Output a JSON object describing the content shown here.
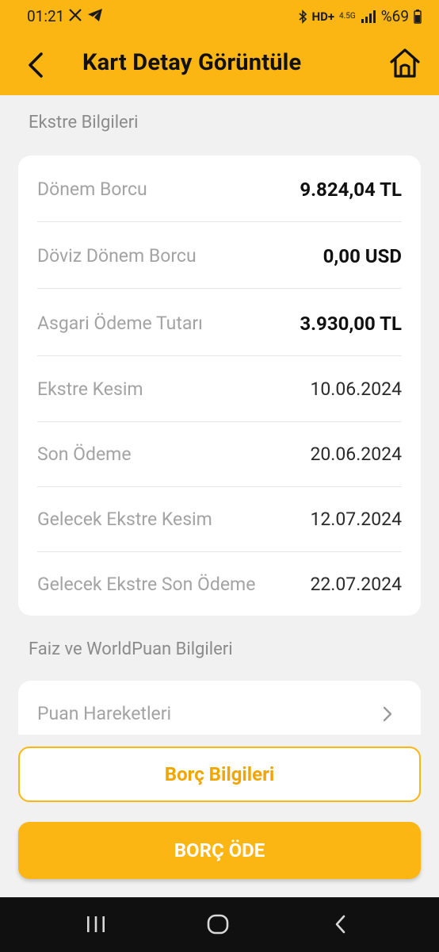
{
  "status": {
    "time": "01:21",
    "network": "4.5G",
    "battery": "%69"
  },
  "header": {
    "title": "Kart Detay Görüntüle"
  },
  "statement": {
    "section_title": "Ekstre Bilgileri",
    "rows": [
      {
        "label": "Dönem Borcu",
        "value": "9.824,04 TL"
      },
      {
        "label": "Döviz Dönem Borcu",
        "value": "0,00 USD"
      },
      {
        "label": "Asgari Ödeme Tutarı",
        "value": "3.930,00 TL"
      },
      {
        "label": "Ekstre Kesim",
        "value": "10.06.2024"
      },
      {
        "label": "Son Ödeme",
        "value": "20.06.2024"
      },
      {
        "label": "Gelecek Ekstre Kesim",
        "value": "12.07.2024"
      },
      {
        "label": "Gelecek Ekstre Son Ödeme",
        "value": "22.07.2024"
      }
    ]
  },
  "points": {
    "section_title": "Faiz ve WorldPuan Bilgileri",
    "items": [
      {
        "label": "Puan Hareketleri"
      }
    ]
  },
  "actions": {
    "debt_info_label": "Borç Bilgileri",
    "pay_debt_label": "BORÇ ÖDE"
  },
  "colors": {
    "brand": "#fbb614",
    "brand_text": "#f0a500"
  }
}
